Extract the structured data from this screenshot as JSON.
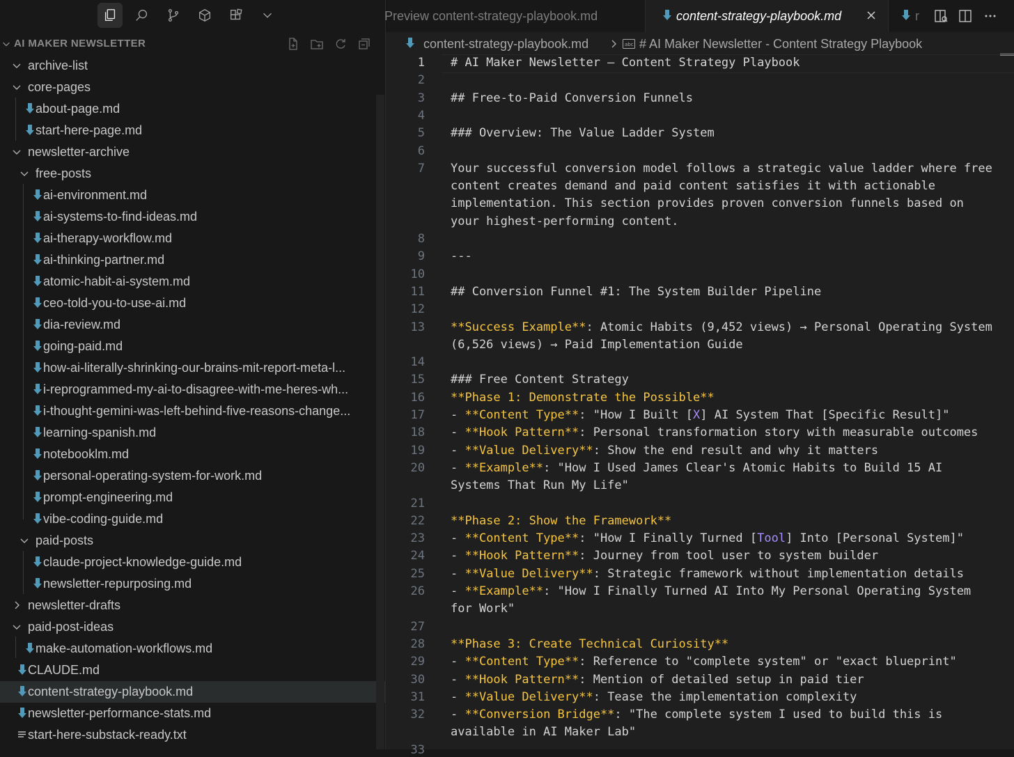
{
  "activity_bar": {
    "icons": [
      "explorer-icon",
      "search-icon",
      "source-control-icon",
      "extensions-cube-icon",
      "extensions-blocks-icon",
      "chevron-down-icon"
    ]
  },
  "explorer": {
    "title": "AI MAKER NEWSLETTER",
    "tree": [
      {
        "label": "archive-list",
        "type": "folder",
        "expanded": true
      },
      {
        "label": "core-pages",
        "type": "folder",
        "expanded": true
      },
      {
        "label": "about-page.md",
        "type": "md"
      },
      {
        "label": "start-here-page.md",
        "type": "md"
      },
      {
        "label": "newsletter-archive",
        "type": "folder",
        "expanded": true
      },
      {
        "label": "free-posts",
        "type": "folder",
        "expanded": true
      },
      {
        "label": "ai-environment.md",
        "type": "md"
      },
      {
        "label": "ai-systems-to-find-ideas.md",
        "type": "md"
      },
      {
        "label": "ai-therapy-workflow.md",
        "type": "md"
      },
      {
        "label": "ai-thinking-partner.md",
        "type": "md"
      },
      {
        "label": "atomic-habit-ai-system.md",
        "type": "md"
      },
      {
        "label": "ceo-told-you-to-use-ai.md",
        "type": "md"
      },
      {
        "label": "dia-review.md",
        "type": "md"
      },
      {
        "label": "going-paid.md",
        "type": "md"
      },
      {
        "label": "how-ai-literally-shrinking-our-brains-mit-report-meta-l...",
        "type": "md"
      },
      {
        "label": "i-reprogrammed-my-ai-to-disagree-with-me-heres-wh...",
        "type": "md"
      },
      {
        "label": "i-thought-gemini-was-left-behind-five-reasons-change...",
        "type": "md"
      },
      {
        "label": "learning-spanish.md",
        "type": "md"
      },
      {
        "label": "notebooklm.md",
        "type": "md"
      },
      {
        "label": "personal-operating-system-for-work.md",
        "type": "md"
      },
      {
        "label": "prompt-engineering.md",
        "type": "md"
      },
      {
        "label": "vibe-coding-guide.md",
        "type": "md"
      },
      {
        "label": "paid-posts",
        "type": "folder",
        "expanded": true
      },
      {
        "label": "claude-project-knowledge-guide.md",
        "type": "md"
      },
      {
        "label": "newsletter-repurposing.md",
        "type": "md"
      },
      {
        "label": "newsletter-drafts",
        "type": "folder",
        "expanded": false
      },
      {
        "label": "paid-post-ideas",
        "type": "folder",
        "expanded": true
      },
      {
        "label": "make-automation-workflows.md",
        "type": "md"
      },
      {
        "label": "CLAUDE.md",
        "type": "md"
      },
      {
        "label": "content-strategy-playbook.md",
        "type": "md",
        "selected": true
      },
      {
        "label": "newsletter-performance-stats.md",
        "type": "md"
      },
      {
        "label": "start-here-substack-ready.txt",
        "type": "txt"
      }
    ]
  },
  "tabs": {
    "preview": "Preview content-strategy-playbook.md",
    "active": "content-strategy-playbook.md",
    "next": "r"
  },
  "breadcrumb": {
    "file": "content-strategy-playbook.md",
    "heading": "# AI Maker Newsletter - Content Strategy Playbook"
  },
  "editor": {
    "current_line": 1,
    "lines": [
      {
        "n": "1",
        "rows": [
          [
            [
              "t",
              "# AI Maker Newsletter – Content Strategy Playbook"
            ]
          ]
        ]
      },
      {
        "n": "2",
        "rows": [
          []
        ]
      },
      {
        "n": "3",
        "rows": [
          [
            [
              "t",
              "## Free-to-Paid Conversion Funnels"
            ]
          ]
        ]
      },
      {
        "n": "4",
        "rows": [
          []
        ]
      },
      {
        "n": "5",
        "rows": [
          [
            [
              "t",
              "### Overview: The Value Ladder System"
            ]
          ]
        ]
      },
      {
        "n": "6",
        "rows": [
          []
        ]
      },
      {
        "n": "7",
        "rows": [
          [
            [
              "t",
              "Your successful conversion model follows a strategic value ladder where free"
            ]
          ],
          [
            [
              "t",
              "content creates demand and paid content satisfies it with actionable"
            ]
          ],
          [
            [
              "t",
              "implementation. This section provides proven conversion funnels based on"
            ]
          ],
          [
            [
              "t",
              "your highest-performing content."
            ]
          ]
        ]
      },
      {
        "n": "8",
        "rows": [
          []
        ]
      },
      {
        "n": "9",
        "rows": [
          [
            [
              "t",
              "---"
            ]
          ]
        ]
      },
      {
        "n": "10",
        "rows": [
          []
        ]
      },
      {
        "n": "11",
        "rows": [
          [
            [
              "t",
              "## Conversion Funnel #1: The System Builder Pipeline"
            ]
          ]
        ]
      },
      {
        "n": "12",
        "rows": [
          []
        ]
      },
      {
        "n": "13",
        "rows": [
          [
            [
              "b",
              "**Success Example**"
            ],
            [
              "t",
              ": Atomic Habits (9,452 views) → Personal Operating System"
            ]
          ],
          [
            [
              "t",
              "(6,526 views) → Paid Implementation Guide"
            ]
          ]
        ]
      },
      {
        "n": "14",
        "rows": [
          []
        ]
      },
      {
        "n": "15",
        "rows": [
          [
            [
              "t",
              "### Free Content Strategy"
            ]
          ]
        ]
      },
      {
        "n": "16",
        "rows": [
          [
            [
              "b",
              "**Phase 1: Demonstrate the Possible**"
            ]
          ]
        ]
      },
      {
        "n": "17",
        "rows": [
          [
            [
              "t",
              "- "
            ],
            [
              "b",
              "**Content Type**"
            ],
            [
              "t",
              ": \"How I Built ["
            ],
            [
              "p",
              "X"
            ],
            [
              "t",
              "] AI System That [Specific Result]\""
            ]
          ]
        ]
      },
      {
        "n": "18",
        "rows": [
          [
            [
              "t",
              "- "
            ],
            [
              "b",
              "**Hook Pattern**"
            ],
            [
              "t",
              ": Personal transformation story with measurable outcomes"
            ]
          ]
        ]
      },
      {
        "n": "19",
        "rows": [
          [
            [
              "t",
              "- "
            ],
            [
              "b",
              "**Value Delivery**"
            ],
            [
              "t",
              ": Show the end result and why it matters"
            ]
          ]
        ]
      },
      {
        "n": "20",
        "rows": [
          [
            [
              "t",
              "- "
            ],
            [
              "b",
              "**Example**"
            ],
            [
              "t",
              ": \"How I Used James Clear's Atomic Habits to Build 15 AI"
            ]
          ],
          [
            [
              "t",
              "Systems That Run My Life\""
            ]
          ]
        ]
      },
      {
        "n": "21",
        "rows": [
          []
        ]
      },
      {
        "n": "22",
        "rows": [
          [
            [
              "b",
              "**Phase 2: Show the Framework**"
            ]
          ]
        ]
      },
      {
        "n": "23",
        "rows": [
          [
            [
              "t",
              "- "
            ],
            [
              "b",
              "**Content Type**"
            ],
            [
              "t",
              ": \"How I Finally Turned ["
            ],
            [
              "p",
              "Tool"
            ],
            [
              "t",
              "] Into [Personal System]\""
            ]
          ]
        ]
      },
      {
        "n": "24",
        "rows": [
          [
            [
              "t",
              "- "
            ],
            [
              "b",
              "**Hook Pattern**"
            ],
            [
              "t",
              ": Journey from tool user to system builder"
            ]
          ]
        ]
      },
      {
        "n": "25",
        "rows": [
          [
            [
              "t",
              "- "
            ],
            [
              "b",
              "**Value Delivery**"
            ],
            [
              "t",
              ": Strategic framework without implementation details"
            ]
          ]
        ]
      },
      {
        "n": "26",
        "rows": [
          [
            [
              "t",
              "- "
            ],
            [
              "b",
              "**Example**"
            ],
            [
              "t",
              ": \"How I Finally Turned AI Into My Personal Operating System"
            ]
          ],
          [
            [
              "t",
              "for Work\""
            ]
          ]
        ]
      },
      {
        "n": "27",
        "rows": [
          []
        ]
      },
      {
        "n": "28",
        "rows": [
          [
            [
              "b",
              "**Phase 3: Create Technical Curiosity**"
            ]
          ]
        ]
      },
      {
        "n": "29",
        "rows": [
          [
            [
              "t",
              "- "
            ],
            [
              "b",
              "**Content Type**"
            ],
            [
              "t",
              ": Reference to \"complete system\" or \"exact blueprint\""
            ]
          ]
        ]
      },
      {
        "n": "30",
        "rows": [
          [
            [
              "t",
              "- "
            ],
            [
              "b",
              "**Hook Pattern**"
            ],
            [
              "t",
              ": Mention of detailed setup in paid tier"
            ]
          ]
        ]
      },
      {
        "n": "31",
        "rows": [
          [
            [
              "t",
              "- "
            ],
            [
              "b",
              "**Value Delivery**"
            ],
            [
              "t",
              ": Tease the implementation complexity"
            ]
          ]
        ]
      },
      {
        "n": "32",
        "rows": [
          [
            [
              "t",
              "- "
            ],
            [
              "b",
              "**Conversion Bridge**"
            ],
            [
              "t",
              ": \"The complete system I used to build this is"
            ]
          ],
          [
            [
              "t",
              "available in AI Maker Lab\""
            ]
          ]
        ]
      },
      {
        "n": "33",
        "rows": [
          []
        ]
      }
    ]
  },
  "colors": {
    "background": "#1f1f1f",
    "sidebar": "#181818",
    "bold_markup": "#f5c542",
    "link_text": "#a88cff",
    "md_icon": "#519aba"
  }
}
